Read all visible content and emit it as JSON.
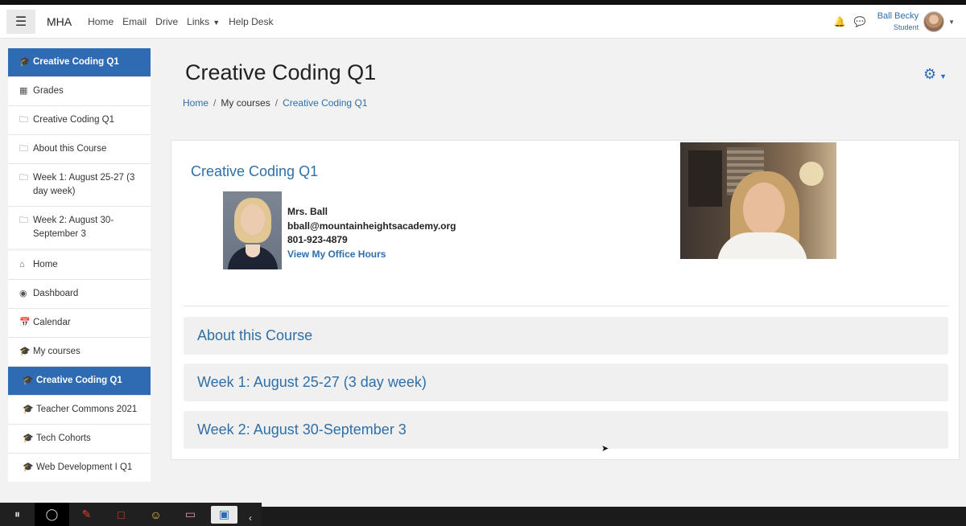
{
  "navbar": {
    "brand": "MHA",
    "links": [
      "Home",
      "Email",
      "Drive",
      "Links",
      "Help Desk"
    ],
    "user_name": "Ball Becky",
    "user_role": "Student"
  },
  "sidebar": {
    "course_items": [
      {
        "label": "Creative Coding Q1",
        "icon": "graduation-cap-icon",
        "active": true
      },
      {
        "label": "Grades",
        "icon": "table-icon"
      },
      {
        "label": "Creative Coding Q1",
        "icon": "folder-icon"
      },
      {
        "label": "About this Course",
        "icon": "folder-icon"
      },
      {
        "label": "Week 1: August 25-27 (3 day week)",
        "icon": "folder-icon"
      },
      {
        "label": "Week 2: August 30-September 3",
        "icon": "folder-icon"
      }
    ],
    "nav_items": [
      {
        "label": "Home",
        "icon": "home-icon"
      },
      {
        "label": "Dashboard",
        "icon": "dashboard-icon"
      },
      {
        "label": "Calendar",
        "icon": "calendar-icon"
      },
      {
        "label": "My courses",
        "icon": "graduation-cap-icon"
      },
      {
        "label": "Creative Coding Q1",
        "icon": "graduation-cap-icon",
        "active": true
      },
      {
        "label": "Teacher Commons 2021",
        "icon": "graduation-cap-icon"
      },
      {
        "label": "Tech Cohorts",
        "icon": "graduation-cap-icon"
      },
      {
        "label": "Web Development I Q1",
        "icon": "graduation-cap-icon"
      }
    ]
  },
  "page": {
    "title": "Creative Coding Q1",
    "breadcrumb": [
      "Home",
      "My courses",
      "Creative Coding Q1"
    ]
  },
  "course": {
    "heading": "Creative Coding Q1",
    "teacher_name": "Mrs. Ball",
    "teacher_email": "bball@mountainheightsacademy.org",
    "teacher_phone": "801-923-4879",
    "office_hours_link": "View My Office Hours"
  },
  "sections": [
    "About this Course",
    "Week 1: August 25-27 (3 day week)",
    "Week 2: August 30-September 3"
  ],
  "colors": {
    "accent": "#2f6bb3",
    "link": "#2f6fa8",
    "section_bg": "#f0f0f0"
  }
}
